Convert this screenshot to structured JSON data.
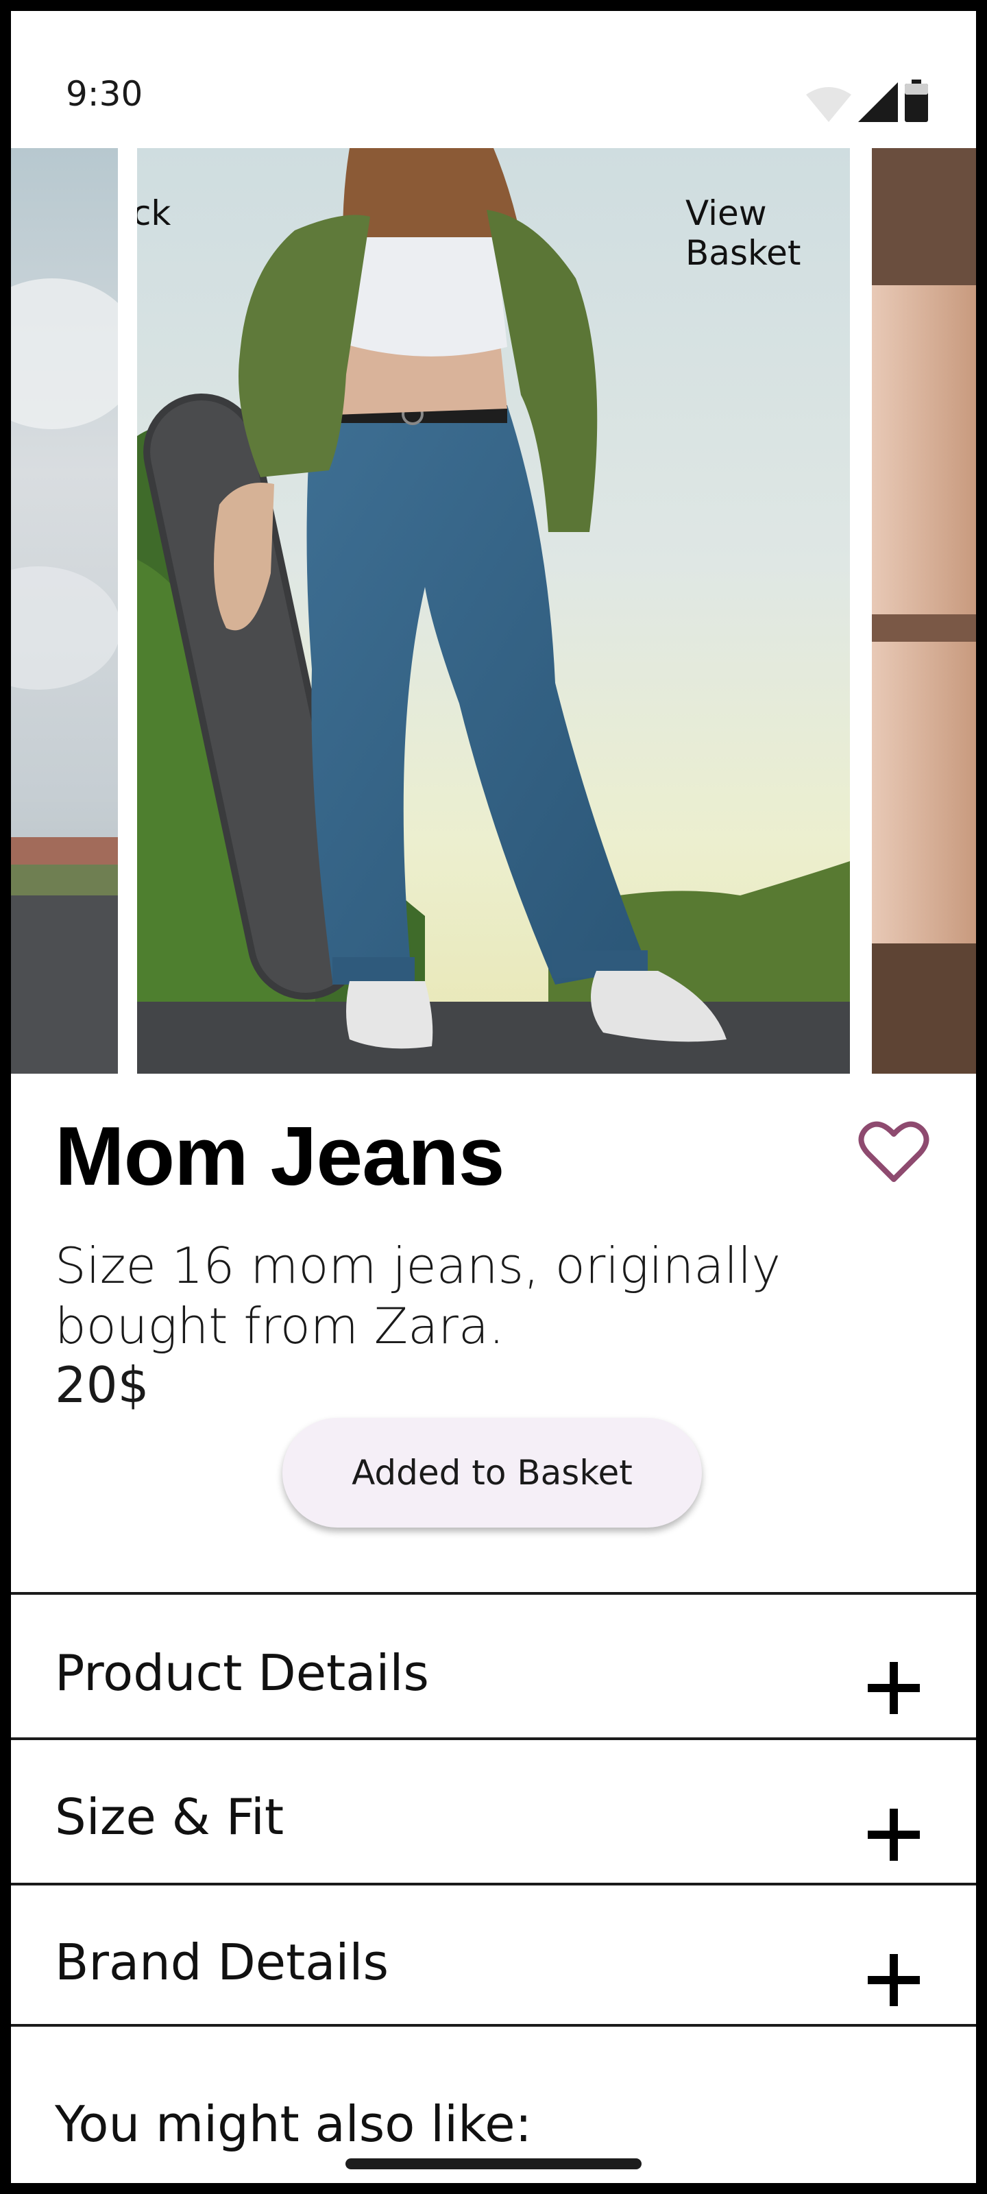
{
  "status_bar": {
    "time": "9:30"
  },
  "nav": {
    "back_label": "Back",
    "basket_label": "View Basket"
  },
  "product": {
    "title": "Mom Jeans",
    "description": "Size 16 mom jeans, originally bought from Zara.",
    "price": "20$",
    "basket_button_label": "Added to Basket",
    "favorite_color": "#8e4a6f"
  },
  "accordions": [
    {
      "label": "Product Details",
      "icon": "plus-icon"
    },
    {
      "label": "Size & Fit",
      "icon": "plus-icon"
    },
    {
      "label": "Brand Details",
      "icon": "plus-icon"
    }
  ],
  "recommendations": {
    "heading": "You might also like:"
  }
}
